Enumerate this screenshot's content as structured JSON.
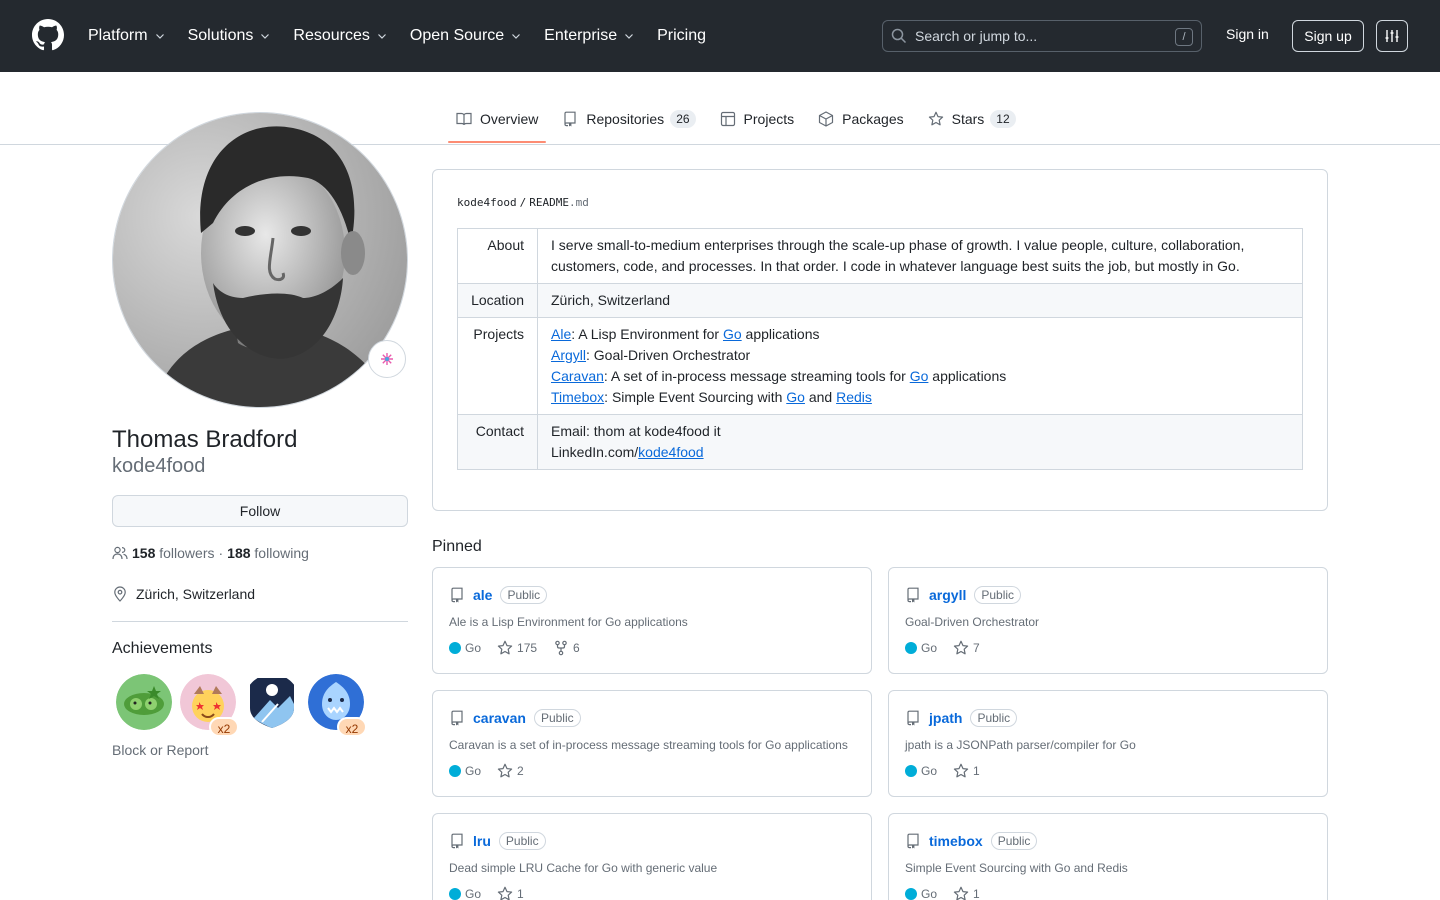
{
  "header": {
    "nav": [
      "Platform",
      "Solutions",
      "Resources",
      "Open Source",
      "Enterprise",
      "Pricing"
    ],
    "search_placeholder": "Search or jump to...",
    "search_shortcut": "/",
    "signin": "Sign in",
    "signup": "Sign up"
  },
  "tabs": [
    {
      "label": "Overview",
      "count": null
    },
    {
      "label": "Repositories",
      "count": "26"
    },
    {
      "label": "Projects",
      "count": null
    },
    {
      "label": "Packages",
      "count": null
    },
    {
      "label": "Stars",
      "count": "12"
    }
  ],
  "profile": {
    "fullname": "Thomas Bradford",
    "username": "kode4food",
    "follow_label": "Follow",
    "followers_count": "158",
    "followers_label": "followers",
    "separator": "·",
    "following_count": "188",
    "following_label": "following",
    "location": "Zürich, Switzerland",
    "achievements_title": "Achievements",
    "achievement_multipliers": [
      "x2",
      "x2"
    ],
    "block_report": "Block or Report"
  },
  "readme": {
    "owner": "kode4food",
    "slash": "/",
    "file_base": "README",
    "file_ext": ".md",
    "rows": {
      "about_key": "About",
      "about_value": "I serve small-to-medium enterprises through the scale-up phase of growth. I value people, culture, collaboration, customers, code, and processes. In that order. I code in whatever language best suits the job, but mostly in Go.",
      "location_key": "Location",
      "location_value": "Zürich, Switzerland",
      "projects_key": "Projects",
      "projects": {
        "p1_link": "Ale",
        "p1_text_a": ": A Lisp Environment for ",
        "p1_link2": "Go",
        "p1_text_b": " applications",
        "p2_link": "Argyll",
        "p2_text": ": Goal-Driven Orchestrator",
        "p3_link": "Caravan",
        "p3_text_a": ": A set of in-process message streaming tools for ",
        "p3_link2": "Go",
        "p3_text_b": " applications",
        "p4_link": "Timebox",
        "p4_text_a": ": Simple Event Sourcing with ",
        "p4_link2": "Go",
        "p4_text_b": " and ",
        "p4_link3": "Redis"
      },
      "contact_key": "Contact",
      "contact_email": "Email: thom at kode4food it",
      "contact_linkedin_prefix": "LinkedIn.com/",
      "contact_linkedin_link": "kode4food"
    }
  },
  "pinned": {
    "title": "Pinned",
    "repos": [
      {
        "name": "ale",
        "visibility": "Public",
        "description": "Ale is a Lisp Environment for Go applications",
        "language": "Go",
        "stars": "175",
        "forks": "6"
      },
      {
        "name": "argyll",
        "visibility": "Public",
        "description": "Goal-Driven Orchestrator",
        "language": "Go",
        "stars": "7",
        "forks": null
      },
      {
        "name": "caravan",
        "visibility": "Public",
        "description": "Caravan is a set of in-process message streaming tools for Go applications",
        "language": "Go",
        "stars": "2",
        "forks": null
      },
      {
        "name": "jpath",
        "visibility": "Public",
        "description": "jpath is a JSONPath parser/compiler for Go",
        "language": "Go",
        "stars": "1",
        "forks": null
      },
      {
        "name": "lru",
        "visibility": "Public",
        "description": "Dead simple LRU Cache for Go with generic value",
        "language": "Go",
        "stars": "1",
        "forks": null
      },
      {
        "name": "timebox",
        "visibility": "Public",
        "description": "Simple Event Sourcing with Go and Redis",
        "language": "Go",
        "stars": "1",
        "forks": null
      }
    ]
  },
  "colors": {
    "header_bg": "#24292f",
    "accent_link": "#0969da",
    "tab_underline": "#fd8c73",
    "go_language": "#00add8"
  }
}
